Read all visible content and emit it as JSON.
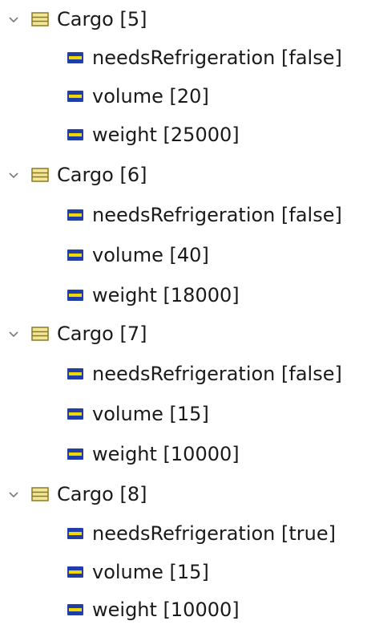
{
  "colors": {
    "class_icon_fill": "#f2e69a",
    "class_icon_border": "#8a7a20",
    "attr_icon_blue": "#1f3ea8",
    "attr_icon_yellow": "#f0d800",
    "twisty": "#7a7a7a",
    "text": "#1a1a1a"
  },
  "icons": {
    "expander": "chevron-down-icon",
    "class_node": "class-table-icon",
    "attribute_node": "attribute-icon"
  },
  "tree": [
    {
      "label": "Cargo [5]",
      "children": [
        {
          "label": "needsRefrigeration [false]"
        },
        {
          "label": "volume [20]"
        },
        {
          "label": "weight [25000]"
        }
      ]
    },
    {
      "label": "Cargo [6]",
      "children": [
        {
          "label": "needsRefrigeration [false]"
        },
        {
          "label": "volume [40]"
        },
        {
          "label": "weight [18000]"
        }
      ]
    },
    {
      "label": "Cargo [7]",
      "children": [
        {
          "label": "needsRefrigeration [false]"
        },
        {
          "label": "volume [15]"
        },
        {
          "label": "weight [10000]"
        }
      ]
    },
    {
      "label": "Cargo [8]",
      "children": [
        {
          "label": "needsRefrigeration [true]"
        },
        {
          "label": "volume [15]"
        },
        {
          "label": "weight [10000]"
        }
      ]
    }
  ]
}
